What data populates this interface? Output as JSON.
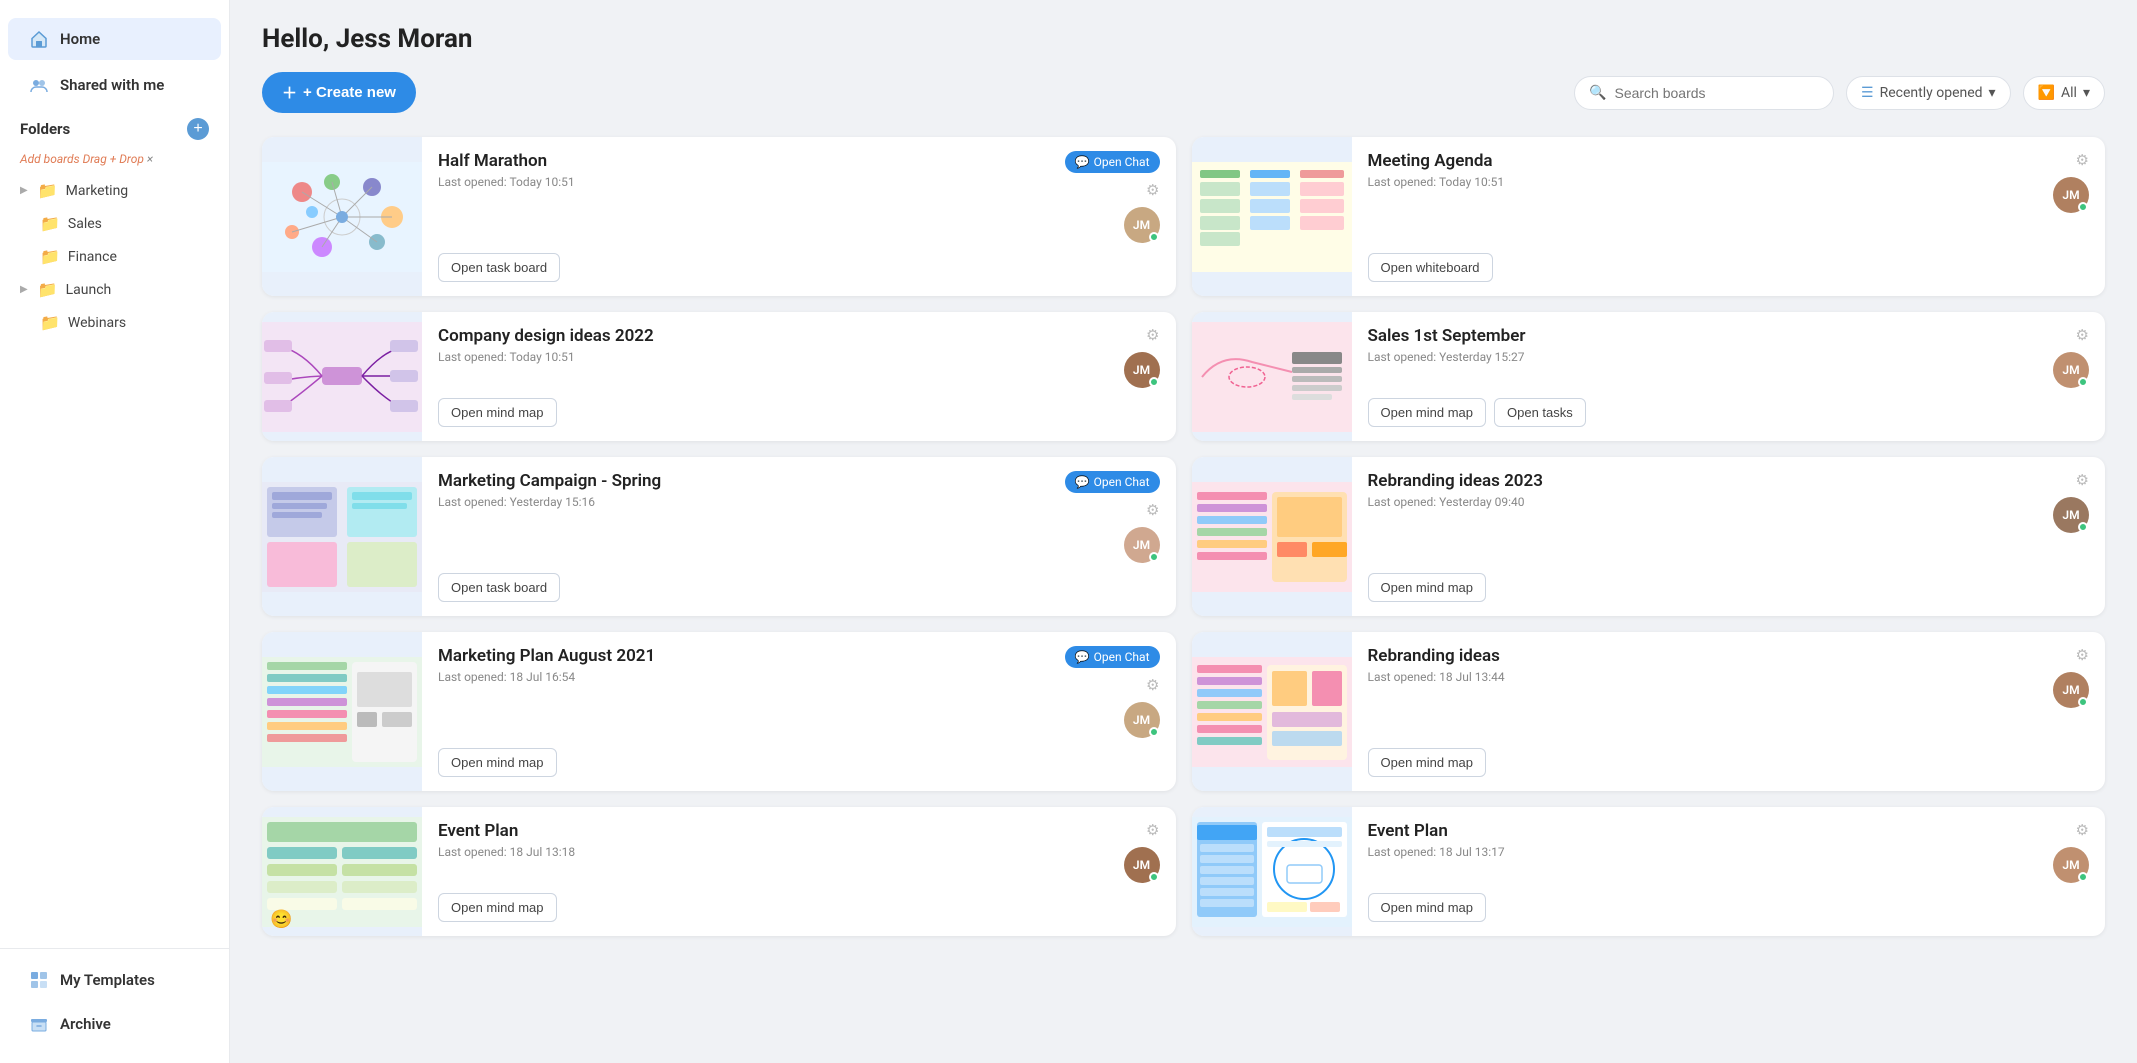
{
  "sidebar": {
    "home_label": "Home",
    "shared_label": "Shared with me",
    "folders_label": "Folders",
    "drag_hint": "Add boards",
    "drag_hint_action": "Drag + Drop",
    "drag_hint_x": "×",
    "folders": [
      {
        "name": "Marketing",
        "has_arrow": true
      },
      {
        "name": "Sales",
        "has_arrow": false
      },
      {
        "name": "Finance",
        "has_arrow": false
      },
      {
        "name": "Launch",
        "has_arrow": true
      },
      {
        "name": "Webinars",
        "has_arrow": false
      }
    ],
    "my_templates_label": "My Templates",
    "archive_label": "Archive"
  },
  "header": {
    "greeting": "Hello, Jess Moran",
    "create_label": "+ Create new",
    "search_placeholder": "Search boards",
    "recently_opened_label": "Recently opened",
    "filter_label": "All"
  },
  "cards": [
    {
      "id": "half-marathon",
      "title": "Half Marathon",
      "meta": "Last opened: Today 10:51",
      "btn1": "Open task board",
      "btn2": null,
      "chat_badge": "Open Chat",
      "thumb_type": "circles",
      "avatar_initials": "JM"
    },
    {
      "id": "meeting-agenda",
      "title": "Meeting Agenda",
      "meta": "Last opened: Today 10:51",
      "btn1": "Open whiteboard",
      "btn2": null,
      "chat_badge": null,
      "thumb_type": "kanban",
      "avatar_initials": "JM"
    },
    {
      "id": "company-design",
      "title": "Company design ideas 2022",
      "meta": "Last opened: Today 10:51",
      "btn1": "Open mind map",
      "btn2": null,
      "chat_badge": null,
      "thumb_type": "mindmap",
      "avatar_initials": "JM"
    },
    {
      "id": "sales-september",
      "title": "Sales 1st September",
      "meta": "Last opened: Yesterday 15:27",
      "btn1": "Open mind map",
      "btn2": "Open tasks",
      "chat_badge": null,
      "thumb_type": "flowchart",
      "avatar_initials": "JM"
    },
    {
      "id": "marketing-spring",
      "title": "Marketing Campaign - Spring",
      "meta": "Last opened: Yesterday 15:16",
      "btn1": "Open task board",
      "btn2": null,
      "chat_badge": "Open Chat",
      "thumb_type": "taskboard",
      "avatar_initials": "JM"
    },
    {
      "id": "rebranding-2023",
      "title": "Rebranding ideas 2023",
      "meta": "Last opened: Yesterday 09:40",
      "btn1": "Open mind map",
      "btn2": null,
      "chat_badge": null,
      "thumb_type": "rebranding",
      "avatar_initials": "JM"
    },
    {
      "id": "marketing-plan-aug",
      "title": "Marketing Plan August 2021",
      "meta": "Last opened: 18 Jul 16:54",
      "btn1": "Open mind map",
      "btn2": null,
      "chat_badge": "Open Chat",
      "thumb_type": "mindmap2",
      "avatar_initials": "JM"
    },
    {
      "id": "rebranding",
      "title": "Rebranding ideas",
      "meta": "Last opened: 18 Jul 13:44",
      "btn1": "Open mind map",
      "btn2": null,
      "chat_badge": null,
      "thumb_type": "rebranding2",
      "avatar_initials": "JM"
    },
    {
      "id": "event-plan-1",
      "title": "Event Plan",
      "meta": "Last opened: 18 Jul 13:18",
      "btn1": "Open mind map",
      "btn2": null,
      "chat_badge": null,
      "thumb_type": "event1",
      "avatar_initials": "JM",
      "emoji": "😊"
    },
    {
      "id": "event-plan-2",
      "title": "Event Plan",
      "meta": "Last opened: 18 Jul 13:17",
      "btn1": "Open mind map",
      "btn2": null,
      "chat_badge": null,
      "thumb_type": "event2",
      "avatar_initials": "JM"
    }
  ]
}
